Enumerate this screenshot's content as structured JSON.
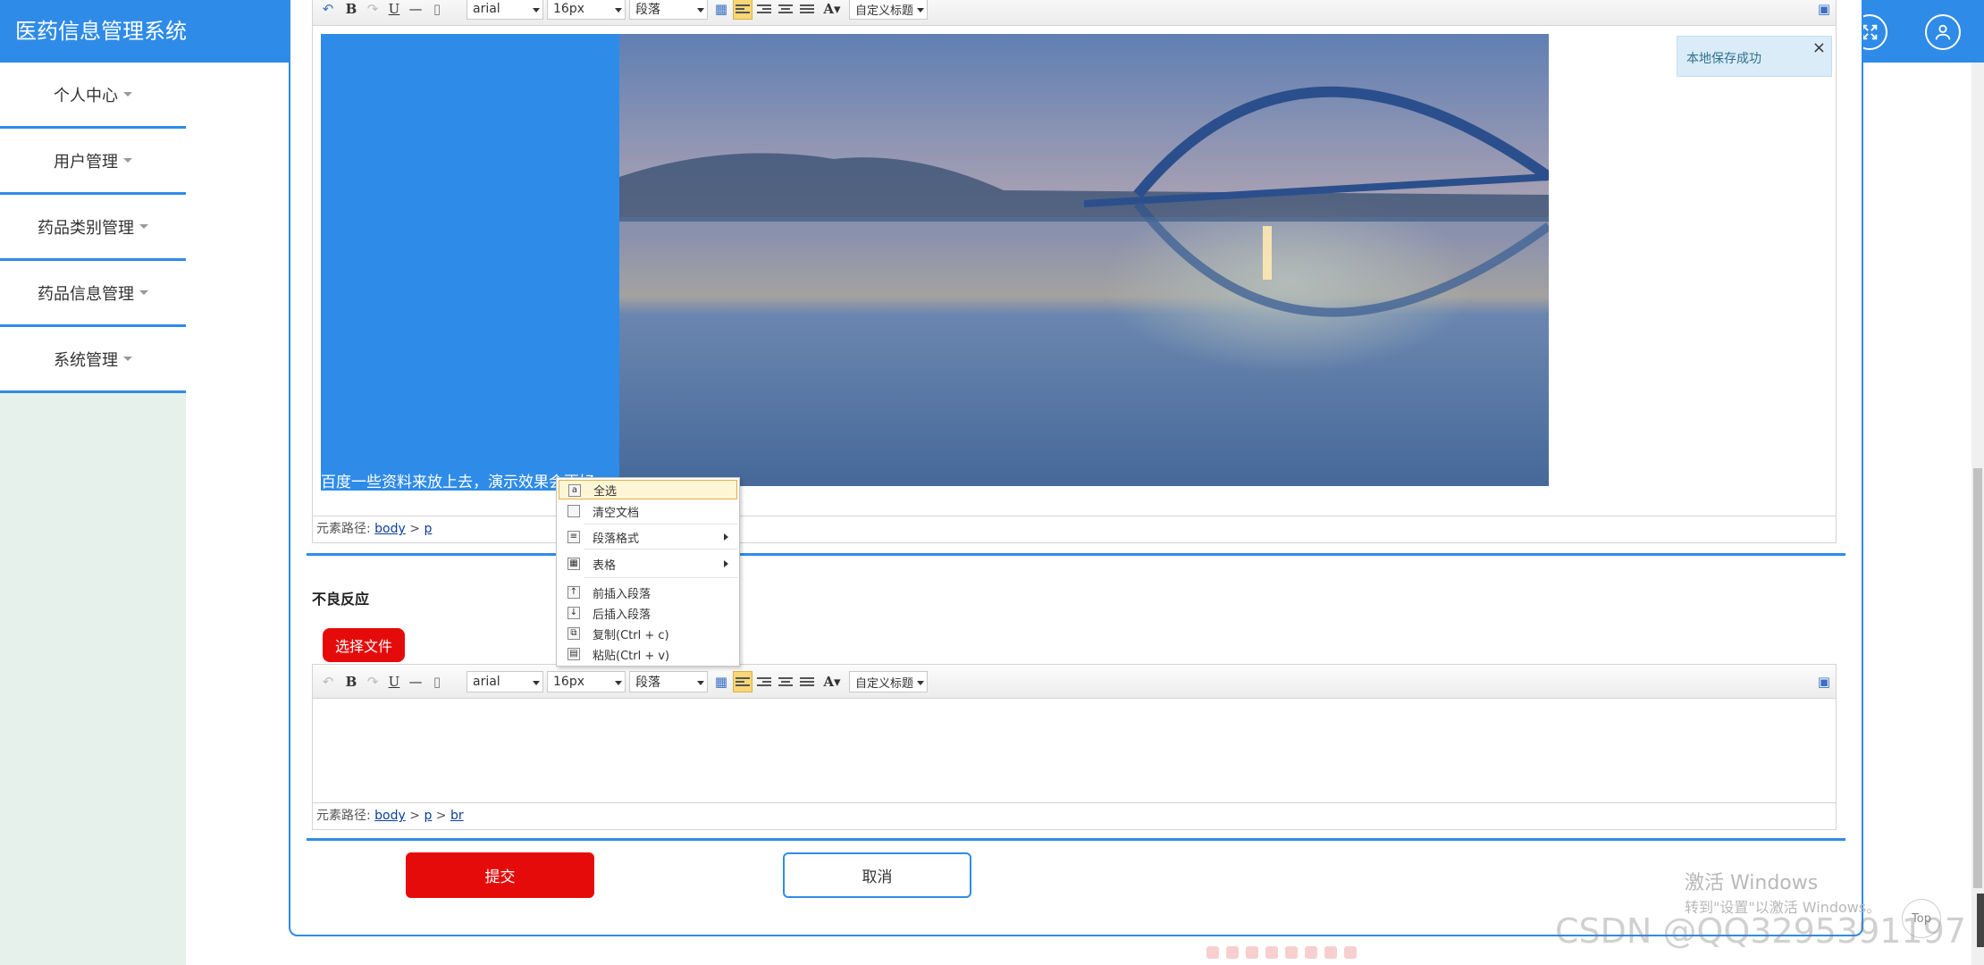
{
  "app": {
    "title": "医药信息管理系统"
  },
  "sidebar": {
    "items": [
      {
        "label": "个人中心"
      },
      {
        "label": "用户管理"
      },
      {
        "label": "药品类别管理"
      },
      {
        "label": "药品信息管理"
      },
      {
        "label": "系统管理"
      }
    ]
  },
  "header": {
    "fullscreen_icon": "fullscreen-icon",
    "user_icon": "user-icon"
  },
  "toolbar": {
    "font_family": "arial",
    "font_size": "16px",
    "paragraph": "段落",
    "custom_title": "自定义标题",
    "font_color_label": "A"
  },
  "editor1": {
    "caption": "百度一些资料来放上去，演示效果会更好",
    "path_label": "元素路径:",
    "path": [
      "body",
      "p"
    ]
  },
  "editor2": {
    "path_label": "元素路径:",
    "path": [
      "body",
      "p",
      "br"
    ]
  },
  "notification": {
    "text": "本地保存成功",
    "close": "×"
  },
  "context_menu": {
    "items": [
      {
        "label": "全选",
        "icon": "select-all-icon"
      },
      {
        "label": "清空文档",
        "icon": "clear-doc-icon"
      },
      {
        "label": "段落格式",
        "icon": "paragraph-format-icon",
        "submenu": true
      },
      {
        "label": "表格",
        "icon": "table-icon",
        "submenu": true
      },
      {
        "label": "前插入段落",
        "icon": "insert-before-icon"
      },
      {
        "label": "后插入段落",
        "icon": "insert-after-icon"
      },
      {
        "label": "复制(Ctrl + c)",
        "icon": "copy-icon"
      },
      {
        "label": "粘贴(Ctrl + v)",
        "icon": "paste-icon"
      }
    ]
  },
  "form": {
    "adverse_label": "不良反应",
    "choose_file": "选择文件",
    "submit": "提交",
    "cancel": "取消"
  },
  "watermark": {
    "windows_title": "激活 Windows",
    "windows_sub": "转到\"设置\"以激活 Windows。",
    "csdn": "CSDN @QQ3295391197",
    "top_btn": "Top"
  },
  "colors": {
    "primary": "#2f8be8",
    "danger": "#e60b0b",
    "sidebar_bg": "#e6f1eb"
  }
}
